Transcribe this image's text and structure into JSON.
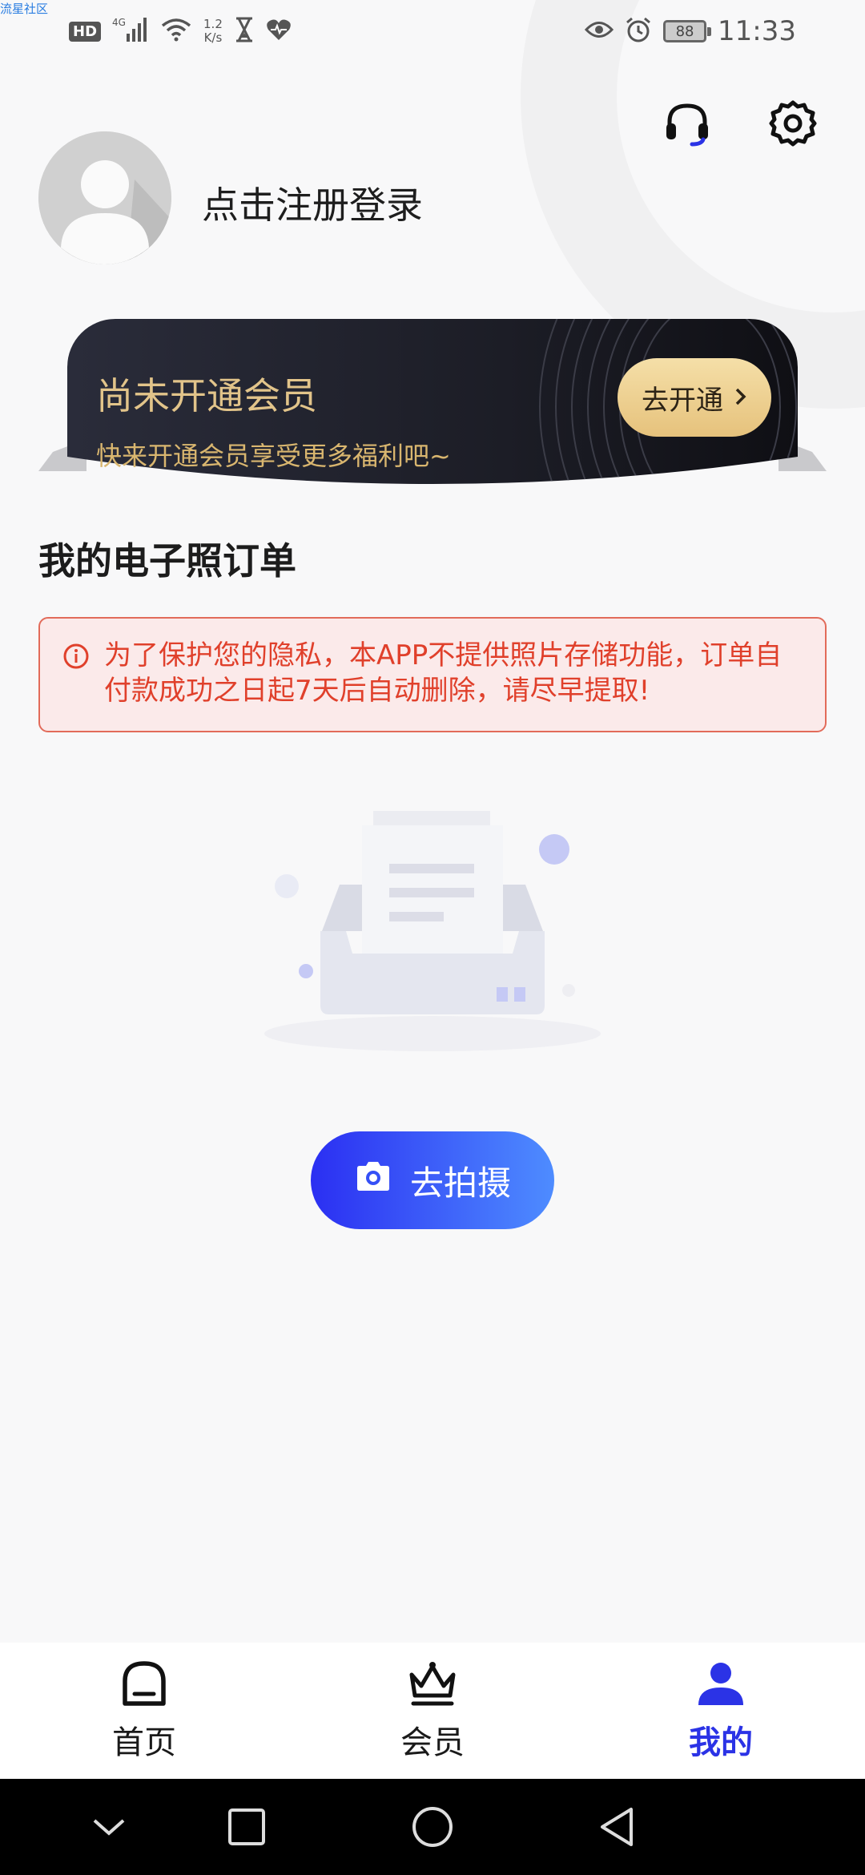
{
  "watermark": "流星社区",
  "status_bar": {
    "network_type": "4G",
    "hd_badge": "HD",
    "speed": "1.2",
    "speed_unit": "K/s",
    "battery": "88",
    "time": "11:33"
  },
  "header": {
    "login_text": "点击注册登录",
    "icons": [
      "headset-icon",
      "gear-icon"
    ]
  },
  "vip_card": {
    "title": "尚未开通会员",
    "subtitle": "快来开通会员享受更多福利吧~",
    "button_label": "去开通"
  },
  "orders": {
    "section_title": "我的电子照订单",
    "notice_text": "为了保护您的隐私，本APP不提供照片存储功能，订单自付款成功之日起7天后自动删除，请尽早提取!",
    "action_label": "去拍摄"
  },
  "tab_bar": {
    "items": [
      {
        "label": "首页",
        "icon": "home-icon",
        "active": false
      },
      {
        "label": "会员",
        "icon": "crown-icon",
        "active": false
      },
      {
        "label": "我的",
        "icon": "profile-icon",
        "active": true
      }
    ]
  },
  "colors": {
    "accent": "#2b33e6",
    "gold": "#e2c48a",
    "warning": "#e0402b"
  }
}
